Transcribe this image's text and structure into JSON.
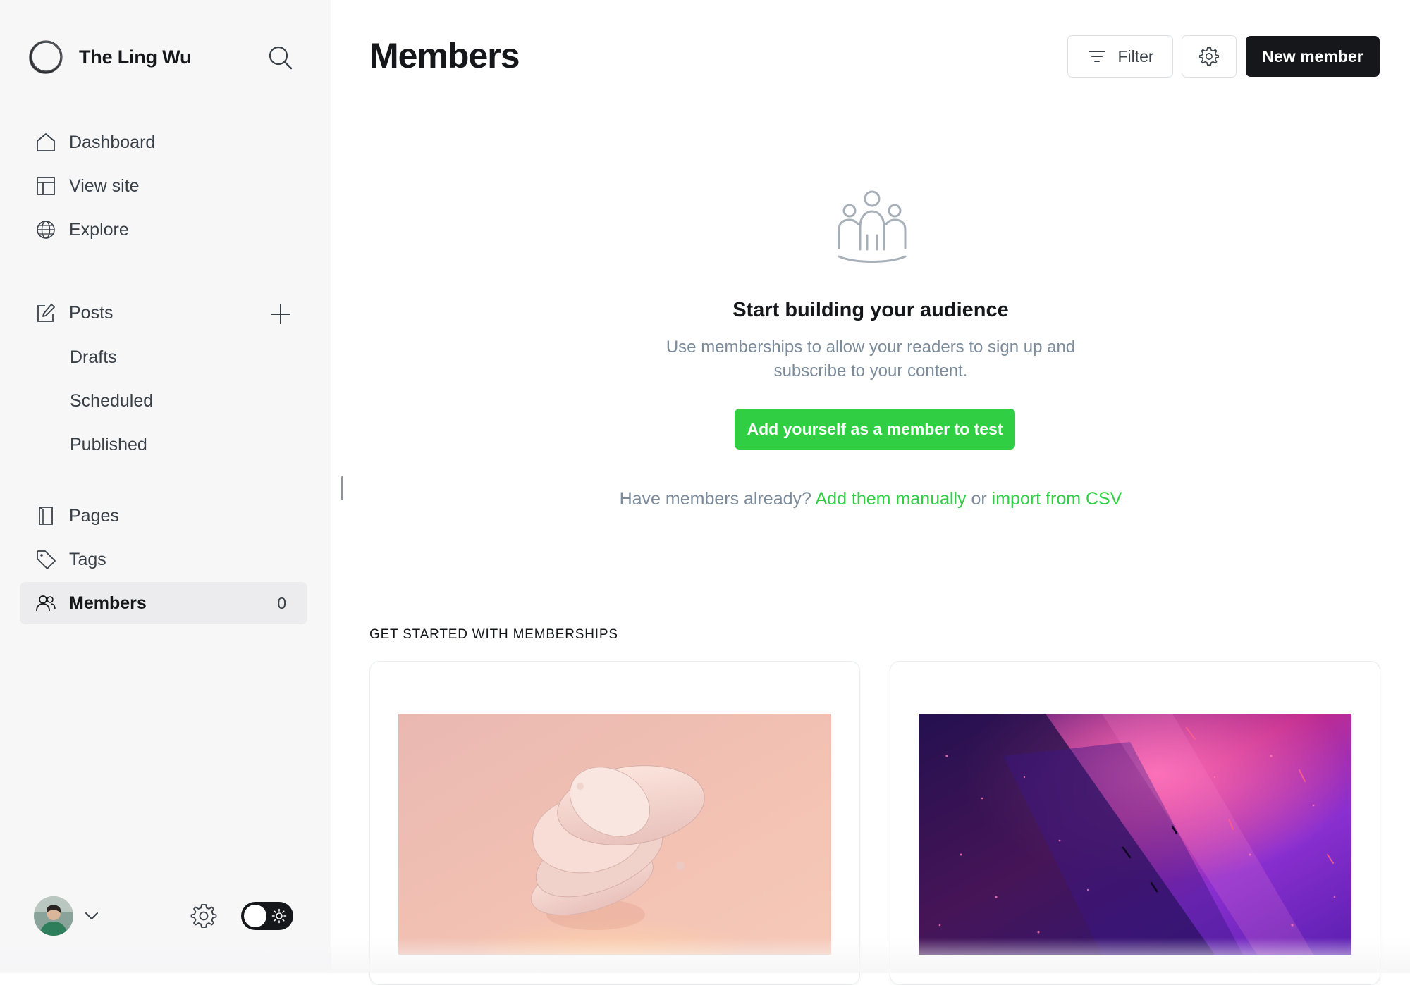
{
  "sidebar": {
    "site_name": "The Ling Wu",
    "nav_primary": [
      {
        "label": "Dashboard",
        "icon": "home-icon"
      },
      {
        "label": "View site",
        "icon": "layout-icon"
      },
      {
        "label": "Explore",
        "icon": "globe-icon"
      }
    ],
    "posts": {
      "label": "Posts",
      "icon": "edit-icon",
      "add_icon": "plus-icon",
      "sub": [
        "Drafts",
        "Scheduled",
        "Published"
      ]
    },
    "nav_secondary": [
      {
        "label": "Pages",
        "icon": "page-icon"
      },
      {
        "label": "Tags",
        "icon": "tag-icon"
      }
    ],
    "members": {
      "label": "Members",
      "icon": "members-icon",
      "count": "0",
      "active": true
    },
    "footer": {
      "avatar": "user-avatar",
      "settings_icon": "gear-icon",
      "theme": "light"
    }
  },
  "header": {
    "title": "Members",
    "filter_label": "Filter",
    "new_member_label": "New member"
  },
  "empty_state": {
    "icon": "audience-icon",
    "title": "Start building your audience",
    "description": "Use memberships to allow your readers to sign up and subscribe to your content.",
    "cta_label": "Add yourself as a member to test",
    "have_members_prefix": "Have members already?",
    "manual_link": "Add them manually",
    "or_text": "or",
    "csv_link": "import from CSV"
  },
  "get_started": {
    "label": "GET STARTED WITH MEMBERSHIPS"
  },
  "colors": {
    "accent": "#30cf43",
    "dark": "#15171a",
    "muted": "#7c8b9a",
    "sidebar_bg": "#f7f7f8"
  }
}
